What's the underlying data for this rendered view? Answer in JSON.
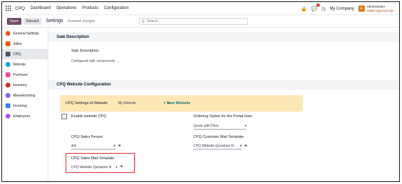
{
  "navbar": {
    "brand": "CPQ",
    "menu": [
      "Dashboard",
      "Operations",
      "Products",
      "Configuration"
    ],
    "notification_count": "1",
    "company": "My Company",
    "avatar_letter": "A",
    "user_name": "Administrator",
    "user_db": "v16ee-cpq-core-QA"
  },
  "controlbar": {
    "save_label": "Save",
    "discard_label": "Discard",
    "title": "Settings",
    "unsaved": "Unsaved changes",
    "search_placeholder": "Search..."
  },
  "sidebar": {
    "items": [
      {
        "label": "General Settings",
        "color": "#ea580c"
      },
      {
        "label": "Sales",
        "color": "#ea580c"
      },
      {
        "label": "CPQ",
        "color": "#4b5563"
      },
      {
        "label": "Website",
        "color": "#0ea5e9"
      },
      {
        "label": "Purchase",
        "color": "#ec4899"
      },
      {
        "label": "Inventory",
        "color": "#dc2626"
      },
      {
        "label": "Manufacturing",
        "color": "#8b5cf6"
      },
      {
        "label": "Invoicing",
        "color": "#3b82f6"
      },
      {
        "label": "Employees",
        "color": "#a855f7"
      }
    ],
    "active_index": 2
  },
  "sale_description": {
    "section_title": "Sale Description",
    "label": "Sale Description",
    "value": "Configured with components →"
  },
  "website_config": {
    "section_title": "CPQ Website Configuration",
    "banner_label": "CPQ Settings of Website",
    "website_value": "My Website",
    "new_website": "+ New Website",
    "enable_label": "Enable website CPQ",
    "ordering_label": "Ordering Option for the Portal User",
    "ordering_value": "Quote with Price",
    "sales_person_label": "CPQ Sales Person",
    "sales_person_value": "Arti",
    "customer_mail_label": "CPQ Customer Mail Template",
    "customer_mail_value": "CPQ Website Quotation N",
    "sales_mail_label": "CPQ Sales Mail Template",
    "sales_mail_value": "CPQ Website Quotation N"
  },
  "colors": {
    "brand_primary": "#714b67",
    "banner": "#fde7b5",
    "highlight": "#dc2626"
  }
}
